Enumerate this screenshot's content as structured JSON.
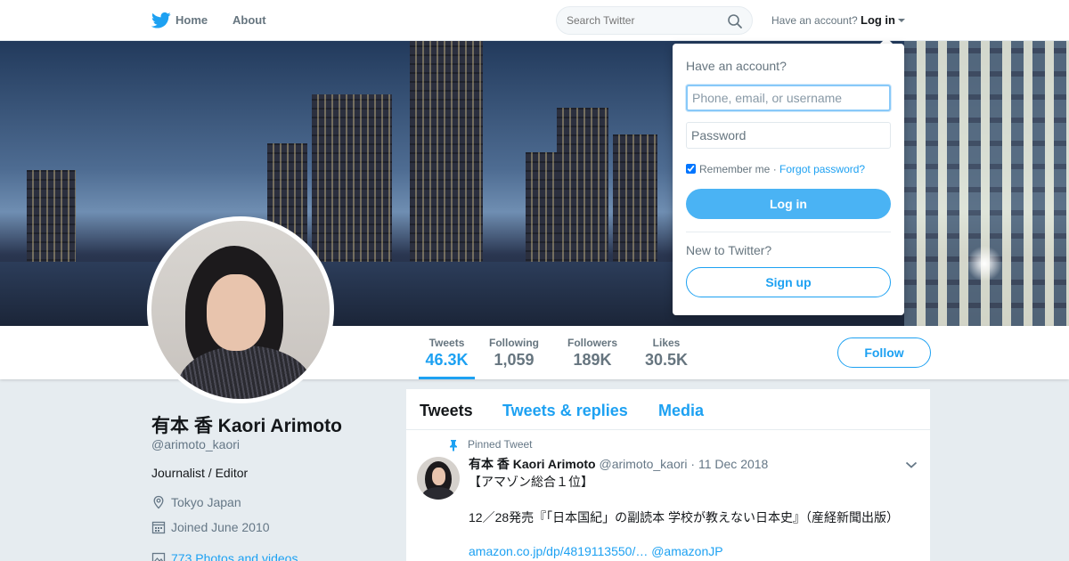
{
  "nav": {
    "home_label": "Home",
    "about_label": "About",
    "search_placeholder": "Search Twitter",
    "have_account": "Have an account?",
    "login_label": "Log in"
  },
  "profile": {
    "name": "有本 香 Kaori Arimoto",
    "handle": "@arimoto_kaori",
    "bio": "Journalist / Editor",
    "location": "Tokyo Japan",
    "joined": "Joined June 2010",
    "photos": "773 Photos and videos"
  },
  "stats": {
    "tweets": {
      "label": "Tweets",
      "value": "46.3K"
    },
    "following": {
      "label": "Following",
      "value": "1,059"
    },
    "followers": {
      "label": "Followers",
      "value": "189K"
    },
    "likes": {
      "label": "Likes",
      "value": "30.5K"
    }
  },
  "follow_label": "Follow",
  "timeline": {
    "tabs": [
      "Tweets",
      "Tweets & replies",
      "Media"
    ],
    "pinned_label": "Pinned Tweet",
    "tweet": {
      "name": "有本 香 Kaori Arimoto",
      "handle": "@arimoto_kaori",
      "separator": "·",
      "date": "11 Dec 2018",
      "line1": "【アマゾン総合１位】",
      "line2": "12／28発売『「日本国紀」の副読本 学校が教えない日本史』（産経新聞出版）",
      "line3": "amazon.co.jp/dp/4819113550/… @amazonJP"
    }
  },
  "login_dropdown": {
    "title": "Have an account?",
    "username_placeholder": "Phone, email, or username",
    "password_placeholder": "Password",
    "remember_label": "Remember me",
    "separator": "·",
    "forgot_label": "Forgot password?",
    "login_button": "Log in",
    "new_label": "New to Twitter?",
    "signup_button": "Sign up"
  },
  "colors": {
    "accent": "#1da1f2",
    "login_button": "#4ab3f4",
    "background": "#e6ecf0"
  }
}
